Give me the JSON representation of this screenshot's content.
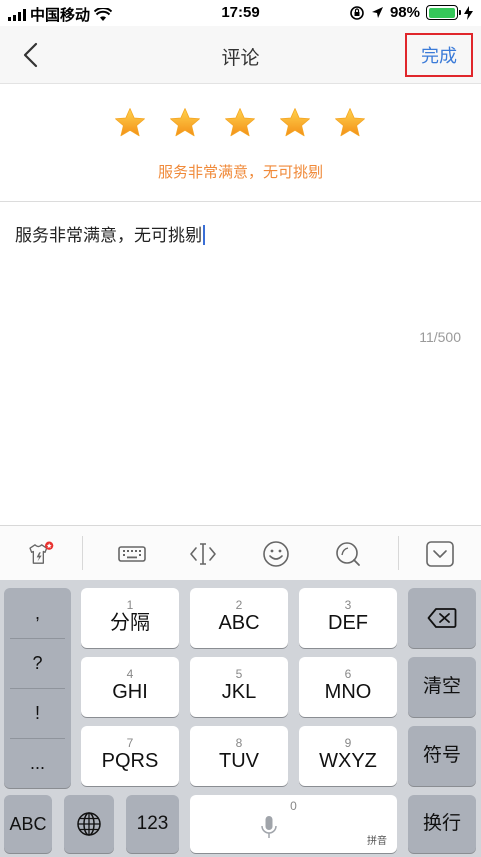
{
  "status_bar": {
    "carrier": "中国移动",
    "time": "17:59",
    "battery": "98%",
    "battery_level": 0.98
  },
  "nav": {
    "title": "评论",
    "done_label": "完成"
  },
  "rating": {
    "stars_filled": 5,
    "stars_total": 5,
    "rating_text": "服务非常满意，无可挑剔",
    "star_color": "#f5a623"
  },
  "comment": {
    "text": "服务非常满意，无可挑剔",
    "counter": "11/500"
  },
  "toolbar": {
    "items": [
      "skin-icon",
      "keyboard-icon",
      "cursor-move-icon",
      "emoji-icon",
      "search-icon",
      "hide-keyboard-icon"
    ]
  },
  "keyboard": {
    "punctuation": [
      ",",
      "?",
      "!",
      "..."
    ],
    "keys": [
      {
        "num": "1",
        "label": "分隔"
      },
      {
        "num": "2",
        "label": "ABC"
      },
      {
        "num": "3",
        "label": "DEF"
      },
      {
        "num": "4",
        "label": "GHI"
      },
      {
        "num": "5",
        "label": "JKL"
      },
      {
        "num": "6",
        "label": "MNO"
      },
      {
        "num": "7",
        "label": "PQRS"
      },
      {
        "num": "8",
        "label": "TUV"
      },
      {
        "num": "9",
        "label": "WXYZ"
      }
    ],
    "clear_label": "清空",
    "symbol_label": "符号",
    "abc_label": "ABC",
    "num_label": "123",
    "space_num": "0",
    "space_hint": "拼音",
    "return_label": "换行"
  }
}
